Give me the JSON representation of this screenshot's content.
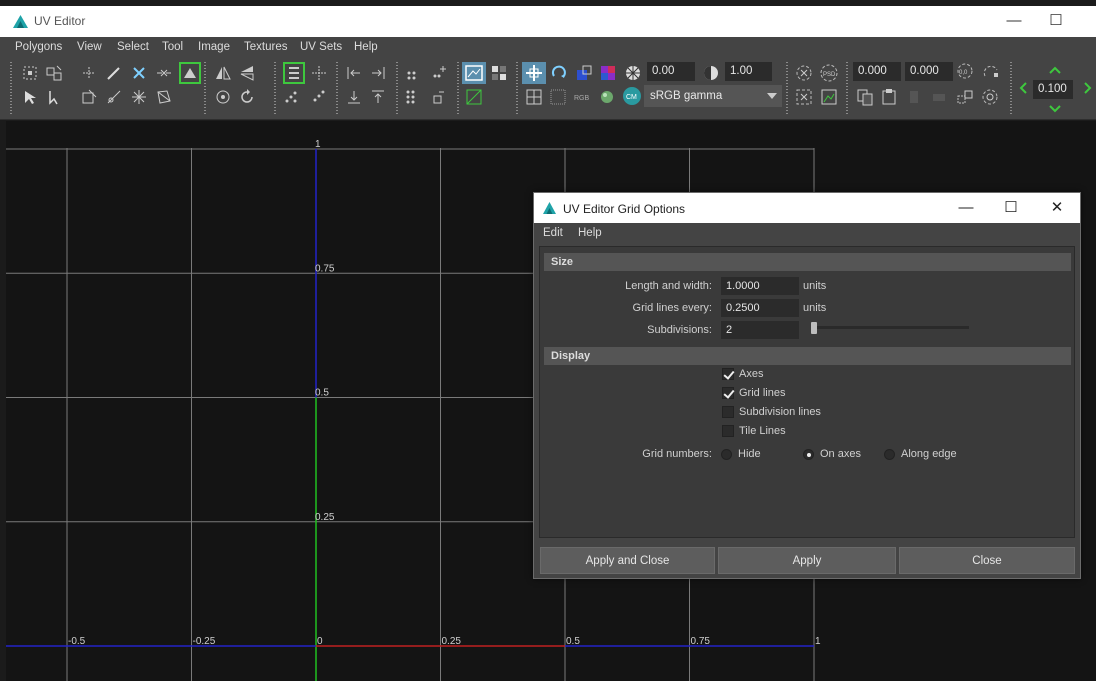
{
  "window": {
    "title": "UV Editor",
    "minimize": "—",
    "maximize": "☐"
  },
  "menu": [
    "Polygons",
    "View",
    "Select",
    "Tool",
    "Image",
    "Textures",
    "UV Sets",
    "Help"
  ],
  "toolbar": {
    "field_a": "0.00",
    "field_b": "1.00",
    "colorspace": "sRGB gamma",
    "u_value": "0.000",
    "v_value": "0.000",
    "step_value": "0.100",
    "icons": [
      "grid-select-icon",
      "uv-shell-icon",
      "cut-icon",
      "brush-icon",
      "sew-icon",
      "move-sew-icon",
      "unfold-icon",
      "flip-u-icon",
      "flip-v-icon",
      "align-icon",
      "snap-icon",
      "distribute-left-icon",
      "distribute-right-icon",
      "image-display-icon",
      "checker-icon",
      "uv-lattice-icon",
      "shade-icon",
      "color-swatch-icon",
      "exposure-icon",
      "gamma-icon",
      "pin-icon",
      "psd-icon",
      "copy-icon",
      "paste-icon",
      "rotate-icon",
      "pixel-snap-icon"
    ]
  },
  "grid": {
    "labels_v": [
      "1",
      "0.75",
      "0.5",
      "0.25"
    ],
    "labels_u": [
      "-0.5",
      "-0.25",
      "0",
      "0.25",
      "0.5",
      "0.75",
      "1"
    ]
  },
  "dialog": {
    "title": "UV Editor Grid Options",
    "menu": [
      "Edit",
      "Help"
    ],
    "size_section": "Size",
    "length_label": "Length and width:",
    "length_value": "1.0000",
    "grid_every_label": "Grid lines every:",
    "grid_every_value": "0.2500",
    "units": "units",
    "subdivisions_label": "Subdivisions:",
    "subdivisions_value": "2",
    "display_section": "Display",
    "checkboxes": [
      {
        "label": "Axes",
        "checked": true
      },
      {
        "label": "Grid lines",
        "checked": true
      },
      {
        "label": "Subdivision lines",
        "checked": false
      },
      {
        "label": "Tile Lines",
        "checked": false
      }
    ],
    "grid_numbers_label": "Grid numbers:",
    "radios": [
      {
        "label": "Hide",
        "checked": false
      },
      {
        "label": "On axes",
        "checked": true
      },
      {
        "label": "Along edge",
        "checked": false
      }
    ],
    "buttons": {
      "apply_close": "Apply and Close",
      "apply": "Apply",
      "close": "Close"
    },
    "window_buttons": {
      "minimize": "—",
      "maximize": "☐",
      "close": "✕"
    }
  },
  "colors": {
    "axis_u": "#c02020",
    "axis_v": "#20c020",
    "axis_blue": "#2323c8",
    "grid": "#7a7a7a"
  }
}
